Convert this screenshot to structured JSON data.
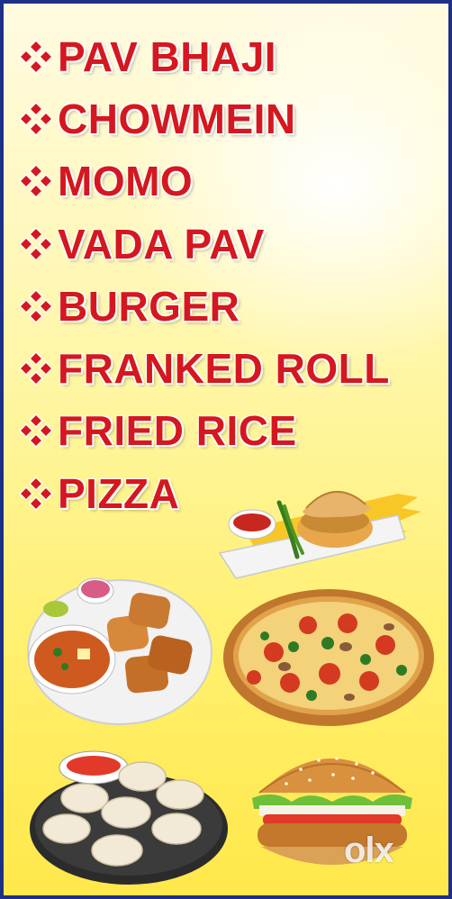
{
  "menu": {
    "items": [
      "PAV BHAJI",
      "CHOWMEIN",
      "MOMO",
      "VADA PAV",
      "BURGER",
      "FRANKED ROLL",
      "FRIED RICE",
      "PIZZA"
    ]
  },
  "images": {
    "vada_pav": "vada-pav-plate-photo",
    "pav_bhaji": "pav-bhaji-plate-photo",
    "pizza": "pizza-photo",
    "momo": "momo-plate-photo",
    "burger": "burger-photo"
  },
  "watermark": {
    "text": "olx"
  },
  "colors": {
    "text": "#d5171f",
    "border": "#1d2f86",
    "background": "#fff6a8"
  }
}
